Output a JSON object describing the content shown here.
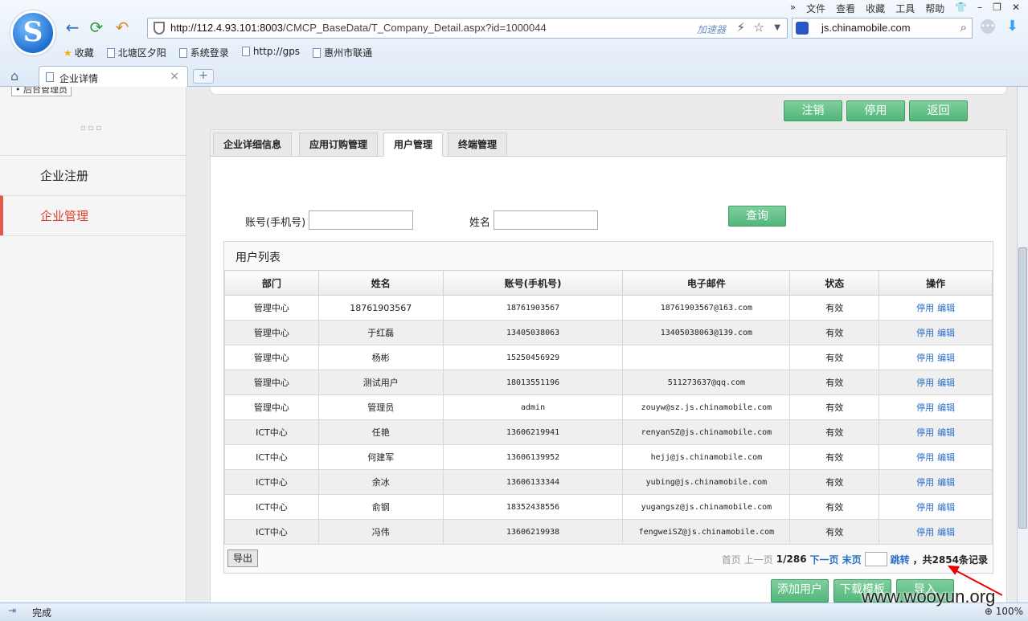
{
  "browser": {
    "menu": [
      "文件",
      "查看",
      "收藏",
      "工具",
      "帮助"
    ],
    "url_host": "http://112.4.93.101:8003",
    "url_path": "/CMCP_BaseData/T_Company_Detail.aspx?id=1000044",
    "accelerator": "加速器",
    "search_text": "js.chinamobile.com",
    "bookmarks": [
      "收藏",
      "北塘区夕阳",
      "系统登录",
      "http://gps",
      "惠州市联通"
    ],
    "tab_title": "企业详情",
    "status_text": "完成",
    "zoom": "100%"
  },
  "sidebar": {
    "role": "后台管理员",
    "items": [
      {
        "label": "企业注册",
        "active": false
      },
      {
        "label": "企业管理",
        "active": true
      }
    ]
  },
  "actions": {
    "cancel": "注销",
    "disable": "停用",
    "back": "返回"
  },
  "tabs": [
    "企业详细信息",
    "应用订购管理",
    "用户管理",
    "终端管理"
  ],
  "filters": {
    "account_label": "账号(手机号)",
    "name_label": "姓名",
    "query_button": "查询"
  },
  "user_list": {
    "title": "用户列表",
    "columns": [
      "部门",
      "姓名",
      "账号(手机号)",
      "电子邮件",
      "状态",
      "操作"
    ],
    "rows": [
      {
        "dept": "管理中心",
        "name": "18761903567",
        "account": "18761903567",
        "email": "18761903567@163.com",
        "status": "有效"
      },
      {
        "dept": "管理中心",
        "name": "于红磊",
        "account": "13405038063",
        "email": "13405038063@139.com",
        "status": "有效"
      },
      {
        "dept": "管理中心",
        "name": "杨彬",
        "account": "15250456929",
        "email": "",
        "status": "有效"
      },
      {
        "dept": "管理中心",
        "name": "测试用户",
        "account": "18013551196",
        "email": "511273637@qq.com",
        "status": "有效"
      },
      {
        "dept": "管理中心",
        "name": "管理员",
        "account": "admin",
        "email": "zouyw@sz.js.chinamobile.com",
        "status": "有效"
      },
      {
        "dept": "ICT中心",
        "name": "任艳",
        "account": "13606219941",
        "email": "renyanSZ@js.chinamobile.com",
        "status": "有效"
      },
      {
        "dept": "ICT中心",
        "name": "何建军",
        "account": "13606139952",
        "email": "hejj@js.chinamobile.com",
        "status": "有效"
      },
      {
        "dept": "ICT中心",
        "name": "余冰",
        "account": "13606133344",
        "email": "yubing@js.chinamobile.com",
        "status": "有效"
      },
      {
        "dept": "ICT中心",
        "name": "俞钢",
        "account": "18352438556",
        "email": "yugangsz@js.chinamobile.com",
        "status": "有效"
      },
      {
        "dept": "ICT中心",
        "name": "冯伟",
        "account": "13606219938",
        "email": "fengweiSZ@js.chinamobile.com",
        "status": "有效"
      }
    ],
    "row_actions": [
      "停用",
      "编辑"
    ]
  },
  "pager": {
    "export": "导出",
    "first": "首页",
    "prev": "上一页",
    "position": "1/286",
    "next": "下一页",
    "last": "末页",
    "jump": "跳转",
    "total": "，共2854条记录"
  },
  "bottom_buttons": {
    "add_user": "添加用户",
    "download_template": "下载模板",
    "import": "导入"
  },
  "watermark": "www.wooyun.org"
}
